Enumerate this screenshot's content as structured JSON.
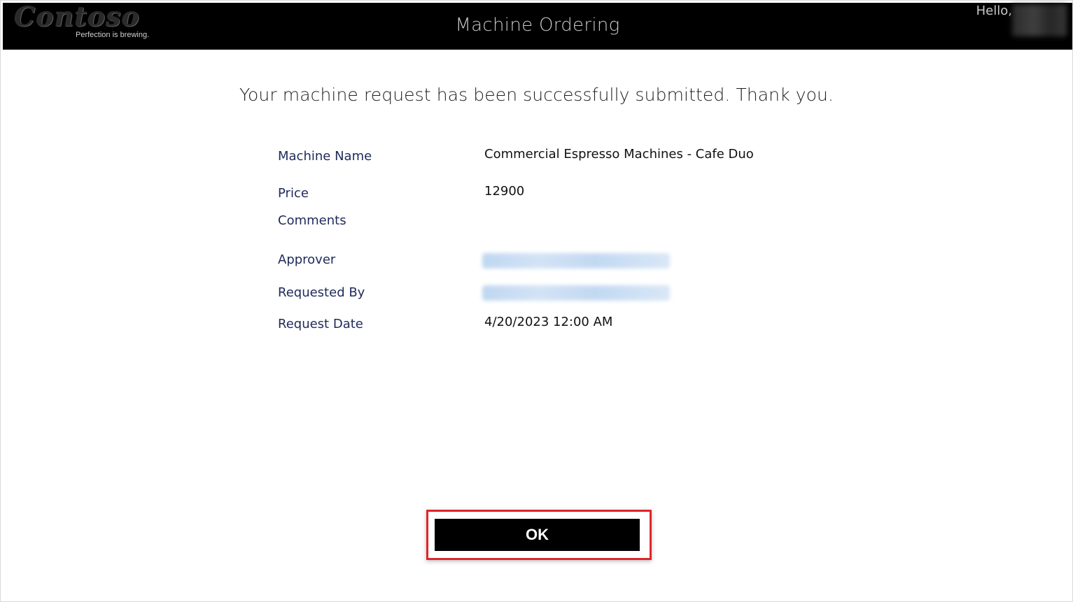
{
  "header": {
    "logo_text": "Contoso",
    "logo_tagline": "Perfection is brewing.",
    "title": "Machine Ordering",
    "greeting": "Hello,"
  },
  "main": {
    "success_message": "Your machine request has been successfully submitted. Thank you.",
    "details": {
      "machine_name_label": "Machine Name",
      "machine_name_value": "Commercial Espresso Machines - Cafe Duo",
      "price_label": "Price",
      "price_value": "12900",
      "comments_label": "Comments",
      "comments_value": "",
      "approver_label": "Approver",
      "requested_by_label": "Requested By",
      "request_date_label": "Request Date",
      "request_date_value": "4/20/2023 12:00 AM"
    },
    "ok_label": "OK"
  },
  "colors": {
    "header_bg": "#000000",
    "label_color": "#1e2a5a",
    "highlight": "#e0252a",
    "button_bg": "#000000",
    "button_text": "#ffffff"
  }
}
